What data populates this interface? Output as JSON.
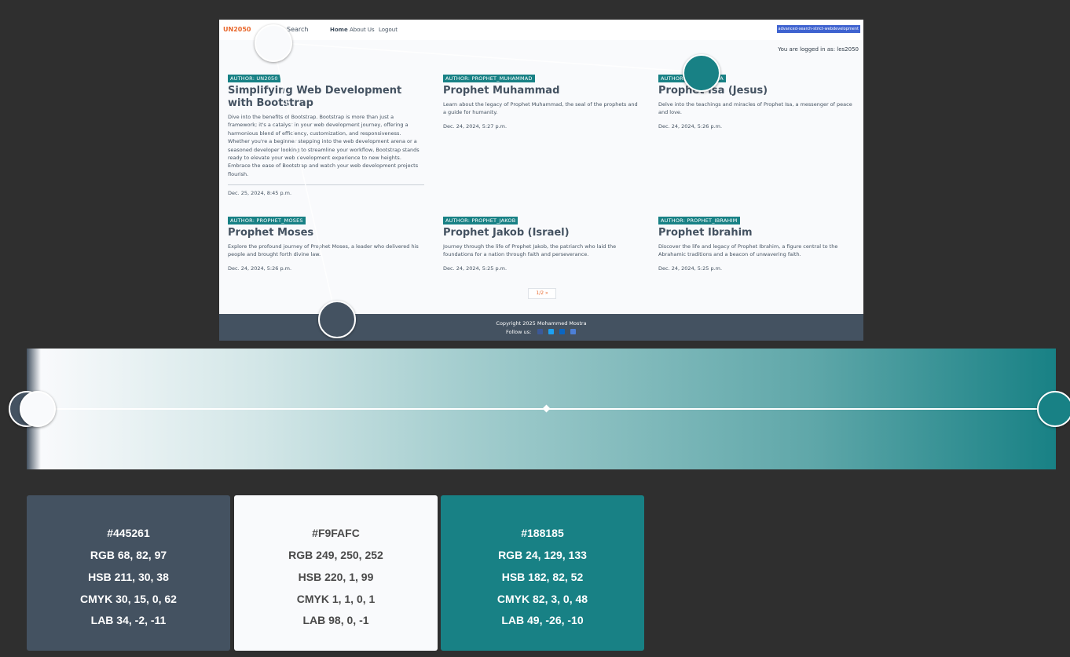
{
  "website": {
    "navbar": {
      "brand": "UN2050",
      "search": "Search",
      "links": [
        "Home",
        "About Us",
        "Logout"
      ],
      "badge": "advanced-search-strict-webdevelopment"
    },
    "logged_in_text": "You are logged in as: les2050",
    "cards": [
      {
        "author": "AUTHOR: UN2050",
        "title": "Simplifying Web Development with Bootstrap",
        "text": "Dive into the benefits of Bootstrap. Bootstrap is more than just a framework; it's a catalyst in your web development journey, offering a harmonious blend of efficiency, customization, and responsiveness. Whether you're a beginner stepping into the web development arena or a seasoned developer looking to streamline your workflow, Bootstrap stands ready to elevate your web development experience to new heights. Embrace the ease of Bootstrap and watch your web development projects flourish.",
        "date": "Dec. 25, 2024, 8:45 p.m."
      },
      {
        "author": "AUTHOR: PROPHET_MUHAMMAD",
        "title": "Prophet Muhammad",
        "text": "Learn about the legacy of Prophet Muhammad, the seal of the prophets and a guide for humanity.",
        "date": "Dec. 24, 2024, 5:27 p.m."
      },
      {
        "author": "AUTHOR: PROPHET_ISA",
        "title": "Prophet Isa (Jesus)",
        "text": "Delve into the teachings and miracles of Prophet Isa, a messenger of peace and love.",
        "date": "Dec. 24, 2024, 5:26 p.m."
      },
      {
        "author": "AUTHOR: PROPHET_MOSES",
        "title": "Prophet Moses",
        "text": "Explore the profound journey of Prophet Moses, a leader who delivered his people and brought forth divine law.",
        "date": "Dec. 24, 2024, 5:26 p.m."
      },
      {
        "author": "AUTHOR: PROPHET_JAKOB",
        "title": "Prophet Jakob (Israel)",
        "text": "Journey through the life of Prophet Jakob, the patriarch who laid the foundations for a nation through faith and perseverance.",
        "date": "Dec. 24, 2024, 5:25 p.m."
      },
      {
        "author": "AUTHOR: PROPHET_IBRAHIM",
        "title": "Prophet Ibrahim",
        "text": "Discover the life and legacy of Prophet Ibrahim, a figure central to the Abrahamic traditions and a beacon of unwavering faith.",
        "date": "Dec. 24, 2024, 5:25 p.m."
      }
    ],
    "pagination": "1/2 »",
    "footer": {
      "copyright": "Copyright 2025 Mohammed Mostra",
      "follow": "Follow us:"
    }
  },
  "swatches": [
    {
      "hex": "#445261",
      "rgb": "RGB 68, 82, 97",
      "hsb": "HSB 211, 30, 38",
      "cmyk": "CMYK 30, 15, 0, 62",
      "lab": "LAB 34, -2, -11",
      "bg": "#445261",
      "fg": "#ffffff"
    },
    {
      "hex": "#F9FAFC",
      "rgb": "RGB 249, 250, 252",
      "hsb": "HSB 220, 1, 99",
      "cmyk": "CMYK 1, 1, 0, 1",
      "lab": "LAB 98, 0, -1",
      "bg": "#f9fafc",
      "fg": "#4a4a4a"
    },
    {
      "hex": "#188185",
      "rgb": "RGB 24, 129, 133",
      "hsb": "HSB 182, 82, 52",
      "cmyk": "CMYK 82, 3, 0, 48",
      "lab": "LAB 49, -26, -10",
      "bg": "#188185",
      "fg": "#ffffff"
    }
  ]
}
